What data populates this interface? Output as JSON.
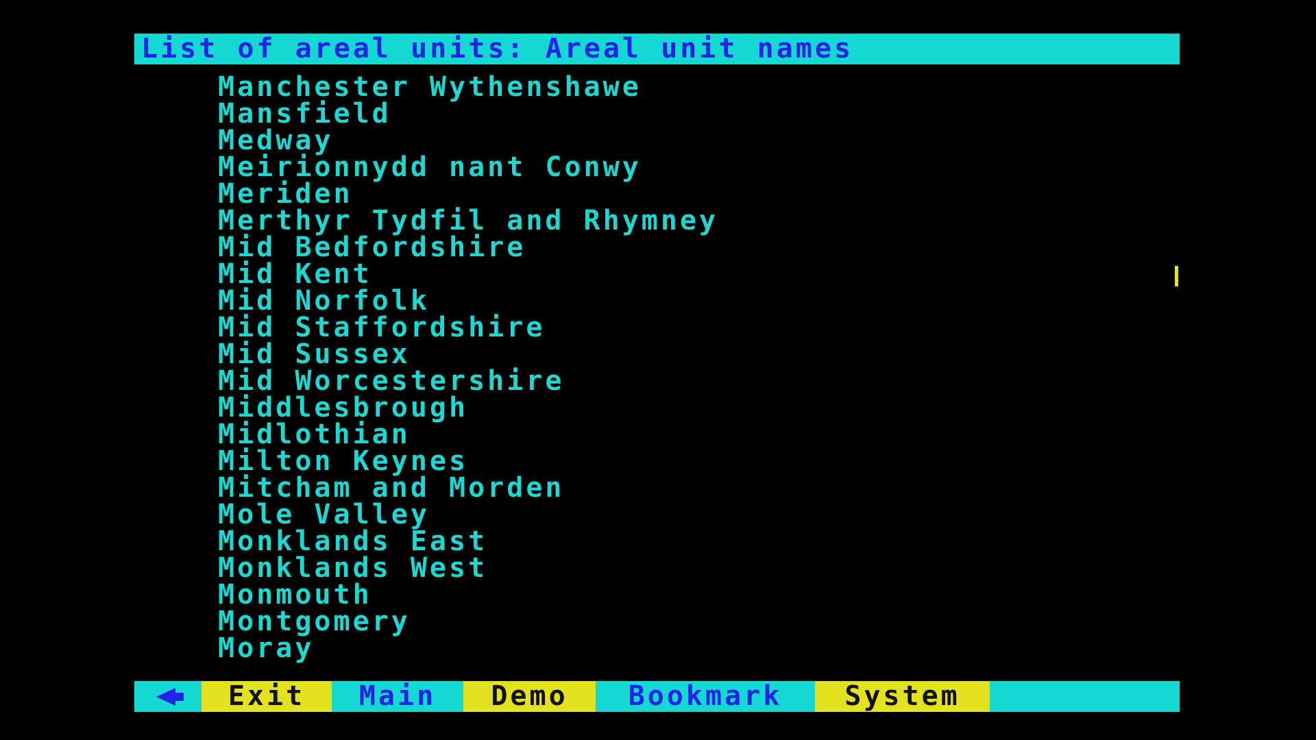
{
  "title": "List of areal units: Areal unit names",
  "items": [
    "Manchester Wythenshawe",
    "Mansfield",
    "Medway",
    "Meirionnydd nant Conwy",
    "Meriden",
    "Merthyr Tydfil and Rhymney",
    "Mid Bedfordshire",
    "Mid Kent",
    "Mid Norfolk",
    "Mid Staffordshire",
    "Mid Sussex",
    "Mid Worcestershire",
    "Middlesbrough",
    "Midlothian",
    "Milton Keynes",
    "Mitcham and Morden",
    "Mole Valley",
    "Monklands East",
    "Monklands West",
    "Monmouth",
    "Montgomery",
    "Moray"
  ],
  "nav": {
    "back_icon": "back-arrow-icon",
    "exit": "Exit",
    "main": "Main",
    "demo": "Demo",
    "bookmark": "Bookmark",
    "system": "System"
  },
  "colors": {
    "background": "#000000",
    "cyan": "#14d8d2",
    "blue_text": "#2323e6",
    "yellow": "#e2e21e",
    "list_text": "#1ed7d0"
  }
}
